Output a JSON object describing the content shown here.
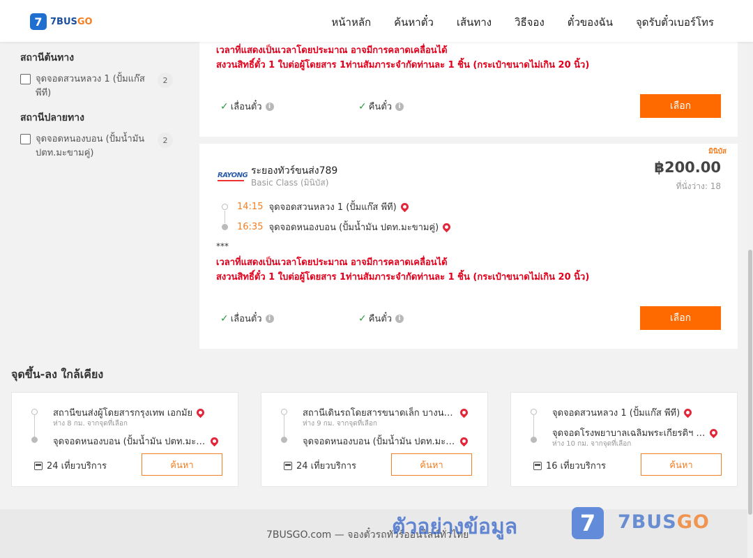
{
  "header": {
    "logo_digit": "7",
    "logo_text": "7BUS",
    "logo_text_go": "GO",
    "nav": [
      "หน้าหลัก",
      "ค้นหาตั๋ว",
      "เส้นทาง",
      "วิธีจอง",
      "ตั๋วของฉัน",
      "จุดรับตั๋วเบอร์โทร"
    ]
  },
  "filters": {
    "origin_title": "สถานีต้นทาง",
    "origin_item": "จุดจอดสวนหลวง 1 (ปั้มแก๊ส พีที)",
    "origin_count": "2",
    "dest_title": "สถานีปลายทาง",
    "dest_item": "จุดจอดหนองบอน (ปั้มน้ำมัน ปตท.มะขามคู่)",
    "dest_count": "2"
  },
  "results": {
    "warn1": "เวลาที่แสดงเป็นเวลาโดยประมาณ อาจมีการคลาดเคลื่อนได้",
    "warn2": "สงวนสิทธิ์ตั๋ว 1 ใบต่อผู้โดยสาร 1ท่านสัมภาระจำกัดท่านละ 1 ชิ้น (กระเป๋าขนาดไม่เกิน 20 นิ้ว)",
    "feature_change": "เลื่อนตั๋ว",
    "feature_refund": "คืนตั๋ว",
    "select_label": "เลือก",
    "card2": {
      "tag": "มินิบัส",
      "operator_logo": "RAYONG",
      "operator": "ระยองทัวร์ขนส่ง789",
      "bus_class": "Basic Class (มินิบัส)",
      "price": "฿200.00",
      "seats": "ที่นั่งว่าง: 18",
      "dep_time": "14:15",
      "dep_stop": "จุดจอดสวนหลวง 1 (ปั้มแก๊ส พีที)",
      "arr_time": "16:35",
      "arr_stop": "จุดจอดหนองบอน (ปั้มน้ำมัน ปตท.มะขามคู่)",
      "stars": "***"
    }
  },
  "nearby": {
    "title": "จุดขึ้น-ลง ใกล้เคียง",
    "search_label": "ค้นหา",
    "cards": [
      {
        "from": "สถานีขนส่งผู้โดยสารกรุงเทพ เอกมัย",
        "from_dist": "ห่าง 8 กม. จากจุดที่เลือก",
        "to": "จุดจอดหนองบอน (ปั้มน้ำมัน ปตท.มะขามคู่)",
        "to_dist": "",
        "trips": "24 เที่ยวบริการ"
      },
      {
        "from": "สถานีเดินรถโดยสารขนาดเล็ก บางนา (ศูนย์การค้า)",
        "from_dist": "ห่าง 9 กม. จากจุดที่เลือก",
        "to": "จุดจอดหนองบอน (ปั้มน้ำมัน ปตท.มะขามคู่)",
        "to_dist": "",
        "trips": "24 เที่ยวบริการ"
      },
      {
        "from": "จุดจอดสวนหลวง 1 (ปั้มแก๊ส พีที)",
        "from_dist": "",
        "to": "จุดจอดโรงพยาบาลเฉลิมพระเกียรติฯ (บางนา)",
        "to_dist": "ห่าง 10 กม. จากจุดที่เลือก",
        "trips": "16 เที่ยวบริการ"
      }
    ]
  },
  "footer": {
    "text": "7BUSGO.com — จองตั๋วรถทัวร์ออนไลน์ทั่วไทย",
    "watermark": "ตัวอย่างข้อมูล",
    "wm_digit": "7",
    "wm_brand": "7BUS",
    "wm_brand_go": "GO"
  }
}
